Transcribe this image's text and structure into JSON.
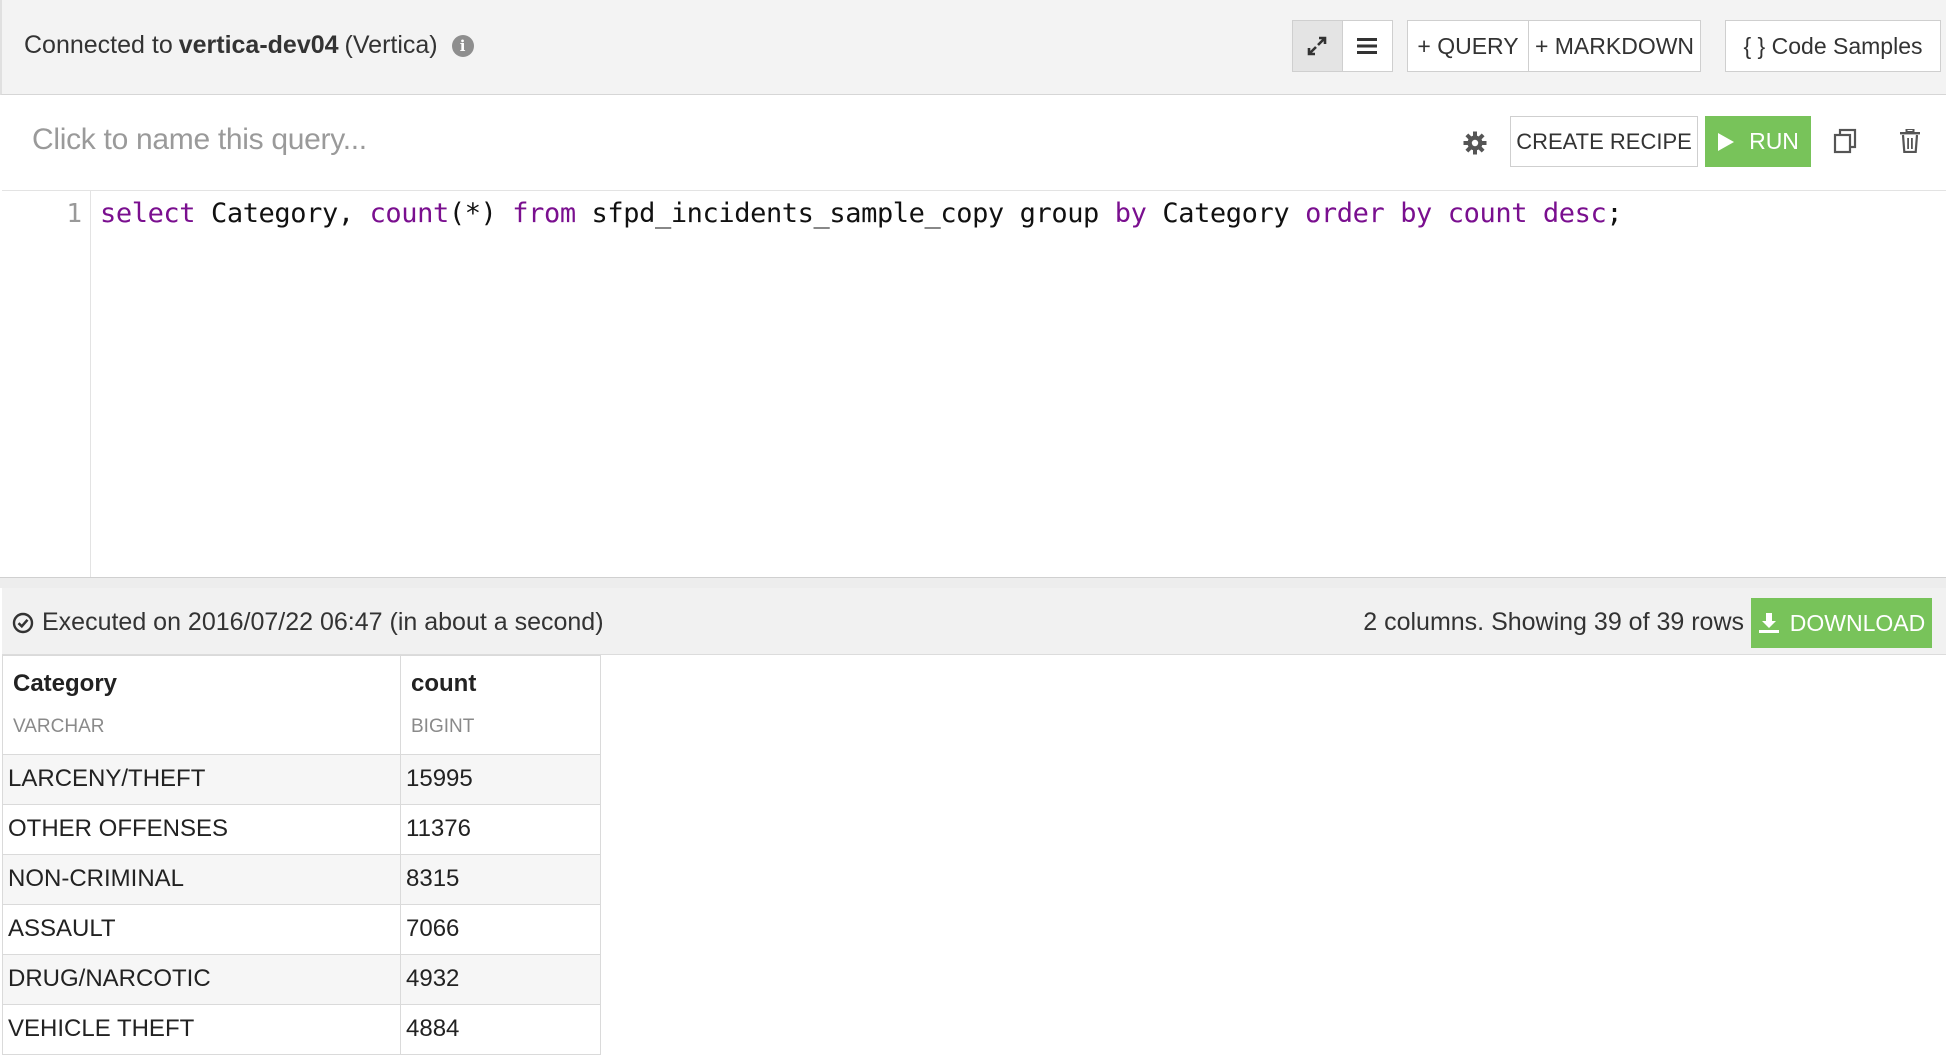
{
  "connection": {
    "prefix": "Connected to",
    "host": "vertica-dev04",
    "engine": "(Vertica)",
    "info_icon": "info-icon"
  },
  "toolbar": {
    "expand_icon": "expand-icon",
    "list_icon": "list-icon",
    "add_query_label": "+ QUERY",
    "add_markdown_label": "+ MARKDOWN",
    "code_samples_label": "{ } Code Samples"
  },
  "query": {
    "name_placeholder": "Click to name this query...",
    "settings_icon": "gear-icon",
    "create_recipe_label": "CREATE RECIPE",
    "run_label": "RUN",
    "duplicate_icon": "copy-icon",
    "delete_icon": "trash-icon"
  },
  "editor": {
    "line_number": "1",
    "tokens": [
      {
        "t": "select",
        "kw": true
      },
      {
        "t": " Category, ",
        "kw": false
      },
      {
        "t": "count",
        "kw": true
      },
      {
        "t": "(*) ",
        "kw": false
      },
      {
        "t": "from",
        "kw": true
      },
      {
        "t": " sfpd_incidents_sample_copy group ",
        "kw": false
      },
      {
        "t": "by",
        "kw": true
      },
      {
        "t": " Category ",
        "kw": false
      },
      {
        "t": "order",
        "kw": true
      },
      {
        "t": " ",
        "kw": false
      },
      {
        "t": "by",
        "kw": true
      },
      {
        "t": " ",
        "kw": false
      },
      {
        "t": "count",
        "kw": true
      },
      {
        "t": " ",
        "kw": false
      },
      {
        "t": "desc",
        "kw": true
      },
      {
        "t": ";",
        "kw": false
      }
    ]
  },
  "results": {
    "executed_text": "Executed on 2016/07/22 06:47 (in about a second)",
    "summary": "2 columns. Showing 39 of 39 rows",
    "download_label": "DOWNLOAD",
    "columns": [
      {
        "name": "Category",
        "type": "VARCHAR"
      },
      {
        "name": "count",
        "type": "BIGINT"
      }
    ],
    "rows": [
      [
        "LARCENY/THEFT",
        "15995"
      ],
      [
        "OTHER OFFENSES",
        "11376"
      ],
      [
        "NON-CRIMINAL",
        "8315"
      ],
      [
        "ASSAULT",
        "7066"
      ],
      [
        "DRUG/NARCOTIC",
        "4932"
      ],
      [
        "VEHICLE THEFT",
        "4884"
      ]
    ]
  },
  "colors": {
    "accent_green": "#78c35a",
    "keyword": "#7a0f8f"
  }
}
